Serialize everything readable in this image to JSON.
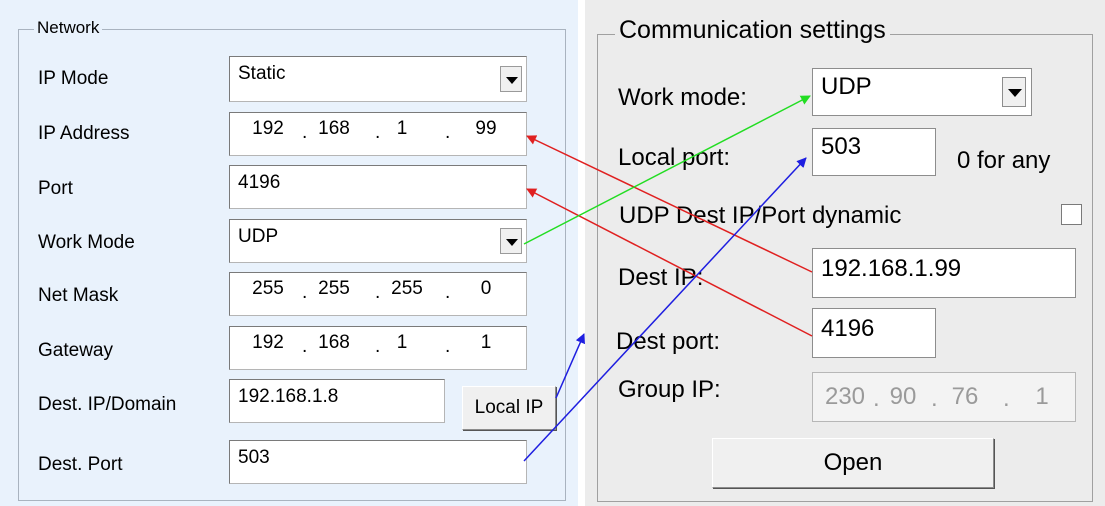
{
  "network": {
    "title": "Network",
    "ip_mode": {
      "label": "IP Mode",
      "value": "Static"
    },
    "ip_address": {
      "label": "IP Address",
      "octets": [
        "192",
        "168",
        "1",
        "99"
      ]
    },
    "port": {
      "label": "Port",
      "value": "4196"
    },
    "work_mode": {
      "label": "Work Mode",
      "value": "UDP"
    },
    "net_mask": {
      "label": "Net Mask",
      "octets": [
        "255",
        "255",
        "255",
        "0"
      ]
    },
    "gateway": {
      "label": "Gateway",
      "octets": [
        "192",
        "168",
        "1",
        "1"
      ]
    },
    "dest_ip": {
      "label": "Dest. IP/Domain",
      "value": "192.168.1.8"
    },
    "local_ip_button": "Local IP",
    "dest_port": {
      "label": "Dest. Port",
      "value": "503"
    }
  },
  "comm": {
    "title": "Communication settings",
    "work_mode": {
      "label": "Work mode:",
      "value": "UDP"
    },
    "local_port": {
      "label": "Local port:",
      "value": "503",
      "hint": "0 for any"
    },
    "udp_dynamic": {
      "label": "UDP Dest IP/Port dynamic",
      "checked": false
    },
    "dest_ip": {
      "label": "Dest IP:",
      "value": "192.168.1.99"
    },
    "dest_port": {
      "label": "Dest port:",
      "value": "4196"
    },
    "group_ip": {
      "label": "Group IP:",
      "octets": [
        "230",
        "90",
        "76",
        "1"
      ]
    },
    "open_button": "Open"
  },
  "colors": {
    "arrow_red": "#e02020",
    "arrow_green": "#22dd22",
    "arrow_blue": "#1e1ee0"
  }
}
